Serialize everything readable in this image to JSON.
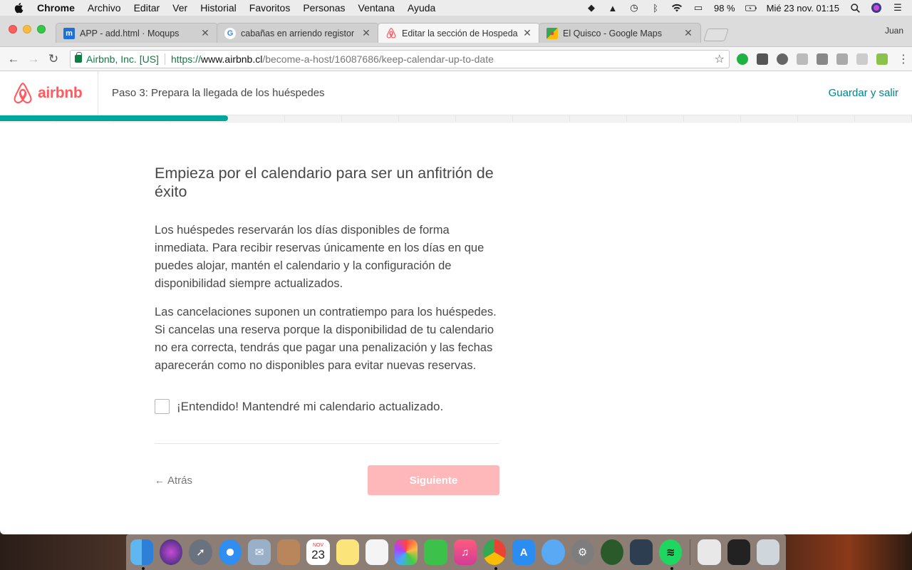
{
  "menubar": {
    "app_name": "Chrome",
    "items": [
      "Archivo",
      "Editar",
      "Ver",
      "Historial",
      "Favoritos",
      "Personas",
      "Ventana",
      "Ayuda"
    ],
    "battery": "98 %",
    "clock": "Mié 23 nov.  01:15"
  },
  "browser": {
    "profile_name": "Juan",
    "tabs": [
      {
        "title": "APP - add.html · Moqups",
        "favicon": "moqups-icon",
        "active": false
      },
      {
        "title": "cabañas en arriendo registor -",
        "favicon": "google-icon",
        "active": false
      },
      {
        "title": "Editar la sección de Hospedar",
        "favicon": "airbnb-icon",
        "active": true
      },
      {
        "title": "El Quisco - Google Maps",
        "favicon": "maps-icon",
        "active": false
      }
    ],
    "security_label": "Airbnb, Inc. [US]",
    "url_protocol": "https://",
    "url_host": "www.airbnb.cl",
    "url_path": "/become-a-host/16087686/keep-calendar-up-to-date"
  },
  "header": {
    "logo_text": "airbnb",
    "step_label": "Paso 3: Prepara la llegada de los huéspedes",
    "save_label": "Guardar y salir",
    "progress": 0.25
  },
  "main": {
    "title": "Empieza por el calendario para ser un anfitrión de éxito",
    "paragraph1": "Los huéspedes reservarán los días disponibles de forma inmediata. Para recibir reservas únicamente en los días en que puedes alojar, mantén el calendario y la configuración de disponibilidad siempre actualizados.",
    "paragraph2": "Las cancelaciones suponen un contratiempo para los huéspedes. Si cancelas una reserva porque la disponibilidad de tu calendario no era correcta, tendrás que pagar una penalización y las fechas aparecerán como no disponibles para evitar nuevas reservas.",
    "checkbox_label": "¡Entendido! Mantendré mi calendario actualizado.",
    "checkbox_checked": false,
    "back_label": "Atrás",
    "next_label": "Siguiente"
  },
  "dock": {
    "calendar_month": "NOV",
    "calendar_day": "23"
  },
  "colors": {
    "brand": "#ff5a5f",
    "teal": "#008489",
    "progress": "#00a699",
    "next_disabled": "#ffb8ba"
  }
}
